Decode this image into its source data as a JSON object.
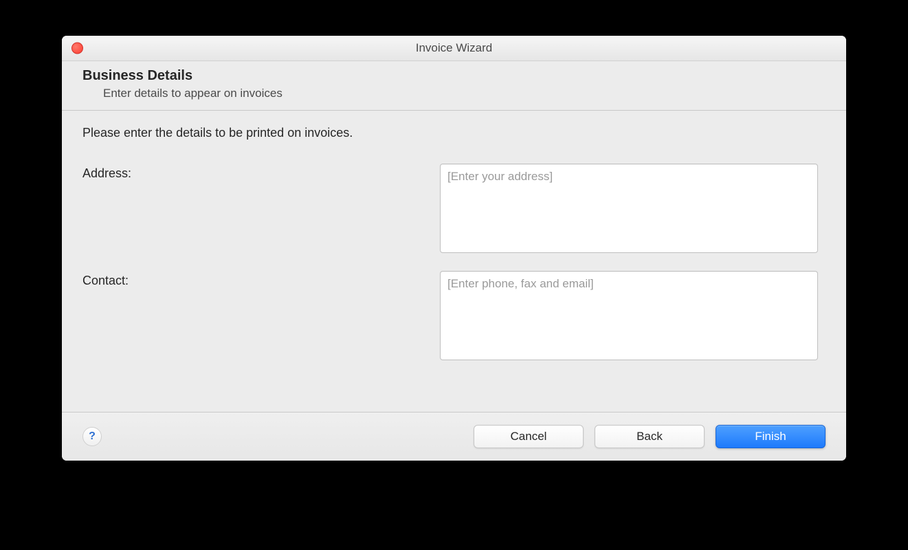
{
  "window": {
    "title": "Invoice Wizard"
  },
  "header": {
    "heading": "Business Details",
    "subheading": "Enter details to appear on invoices"
  },
  "body": {
    "prompt": "Please enter the details to be printed on invoices.",
    "fields": {
      "address": {
        "label": "Address:",
        "value": "",
        "placeholder": "[Enter your address]"
      },
      "contact": {
        "label": "Contact:",
        "value": "",
        "placeholder": "[Enter phone, fax and email]"
      }
    }
  },
  "footer": {
    "help_symbol": "?",
    "buttons": {
      "cancel": "Cancel",
      "back": "Back",
      "finish": "Finish"
    }
  }
}
